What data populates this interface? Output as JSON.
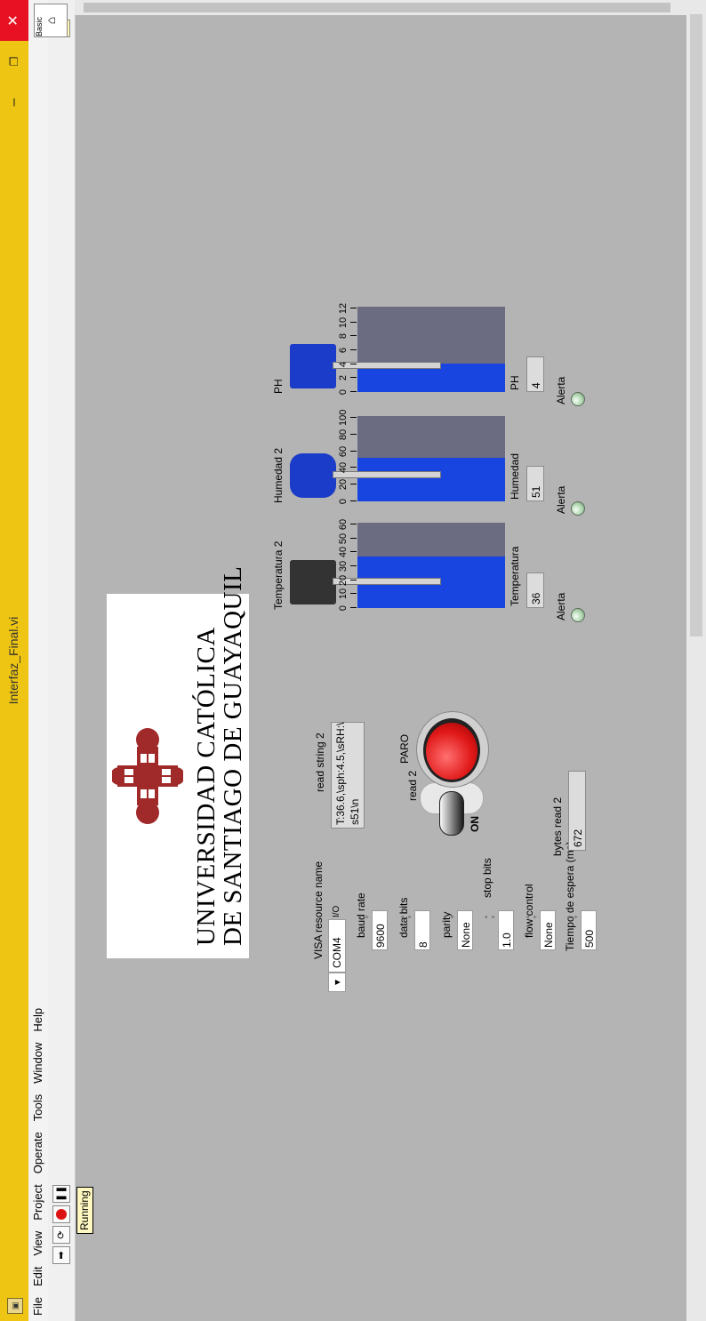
{
  "window": {
    "title": "Interfaz_Final.vi",
    "status": "Running"
  },
  "menu": [
    "File",
    "Edit",
    "View",
    "Project",
    "Operate",
    "Tools",
    "Window",
    "Help"
  ],
  "palette_label": "Basic",
  "logo": {
    "line1": "UNIVERSIDAD CATÓLICA",
    "line2": "DE SANTIAGO DE GUAYAQUIL",
    "crest_color": "#a02a2a"
  },
  "serial": {
    "visa_label": "VISA resource name",
    "visa_value": "COM4",
    "baud_label": "baud rate",
    "baud_value": "9600",
    "databits_label": "data bits",
    "databits_value": "8",
    "parity_label": "parity",
    "parity_value": "None",
    "stopbits_label": "stop bits",
    "stopbits_value": "1.0",
    "flow_label": "flow control",
    "flow_value": "None",
    "wait_label": "Tiempo de espera (ms)",
    "wait_value": "500"
  },
  "read_string": {
    "label": "read string 2",
    "line1": "T:36.6,\\sph:4.5,\\sRH:\\",
    "line2": "s51\\n"
  },
  "bytes_read": {
    "label": "bytes read 2",
    "value": "672"
  },
  "switch": {
    "label": "read 2",
    "state_text": "ON"
  },
  "stop_button": {
    "label": "PARO",
    "color": "#e01818"
  },
  "tanks": [
    {
      "title": "Temperatura 2",
      "ticks": [
        "0",
        "10",
        "20",
        "30",
        "40",
        "50",
        "60"
      ],
      "max": 60,
      "value": 36,
      "display_label": "Temperatura",
      "display_value": "36",
      "alert_label": "Alerta"
    },
    {
      "title": "Humedad 2",
      "ticks": [
        "0",
        "20",
        "40",
        "60",
        "80",
        "100"
      ],
      "max": 100,
      "value": 51,
      "display_label": "Humedad",
      "display_value": "51",
      "alert_label": "Alerta"
    },
    {
      "title": "PH",
      "ticks": [
        "0",
        "2",
        "4",
        "6",
        "8",
        "10",
        "12"
      ],
      "max": 12,
      "value": 4,
      "display_label": "PH",
      "display_value": "4",
      "alert_label": "Alerta"
    }
  ],
  "colors": {
    "titlebar": "#edc512",
    "panel": "#b4b4b4",
    "tank_fill": "#1844e0",
    "tank_empty": "#6b6b82",
    "led": "#a7cfa7"
  }
}
